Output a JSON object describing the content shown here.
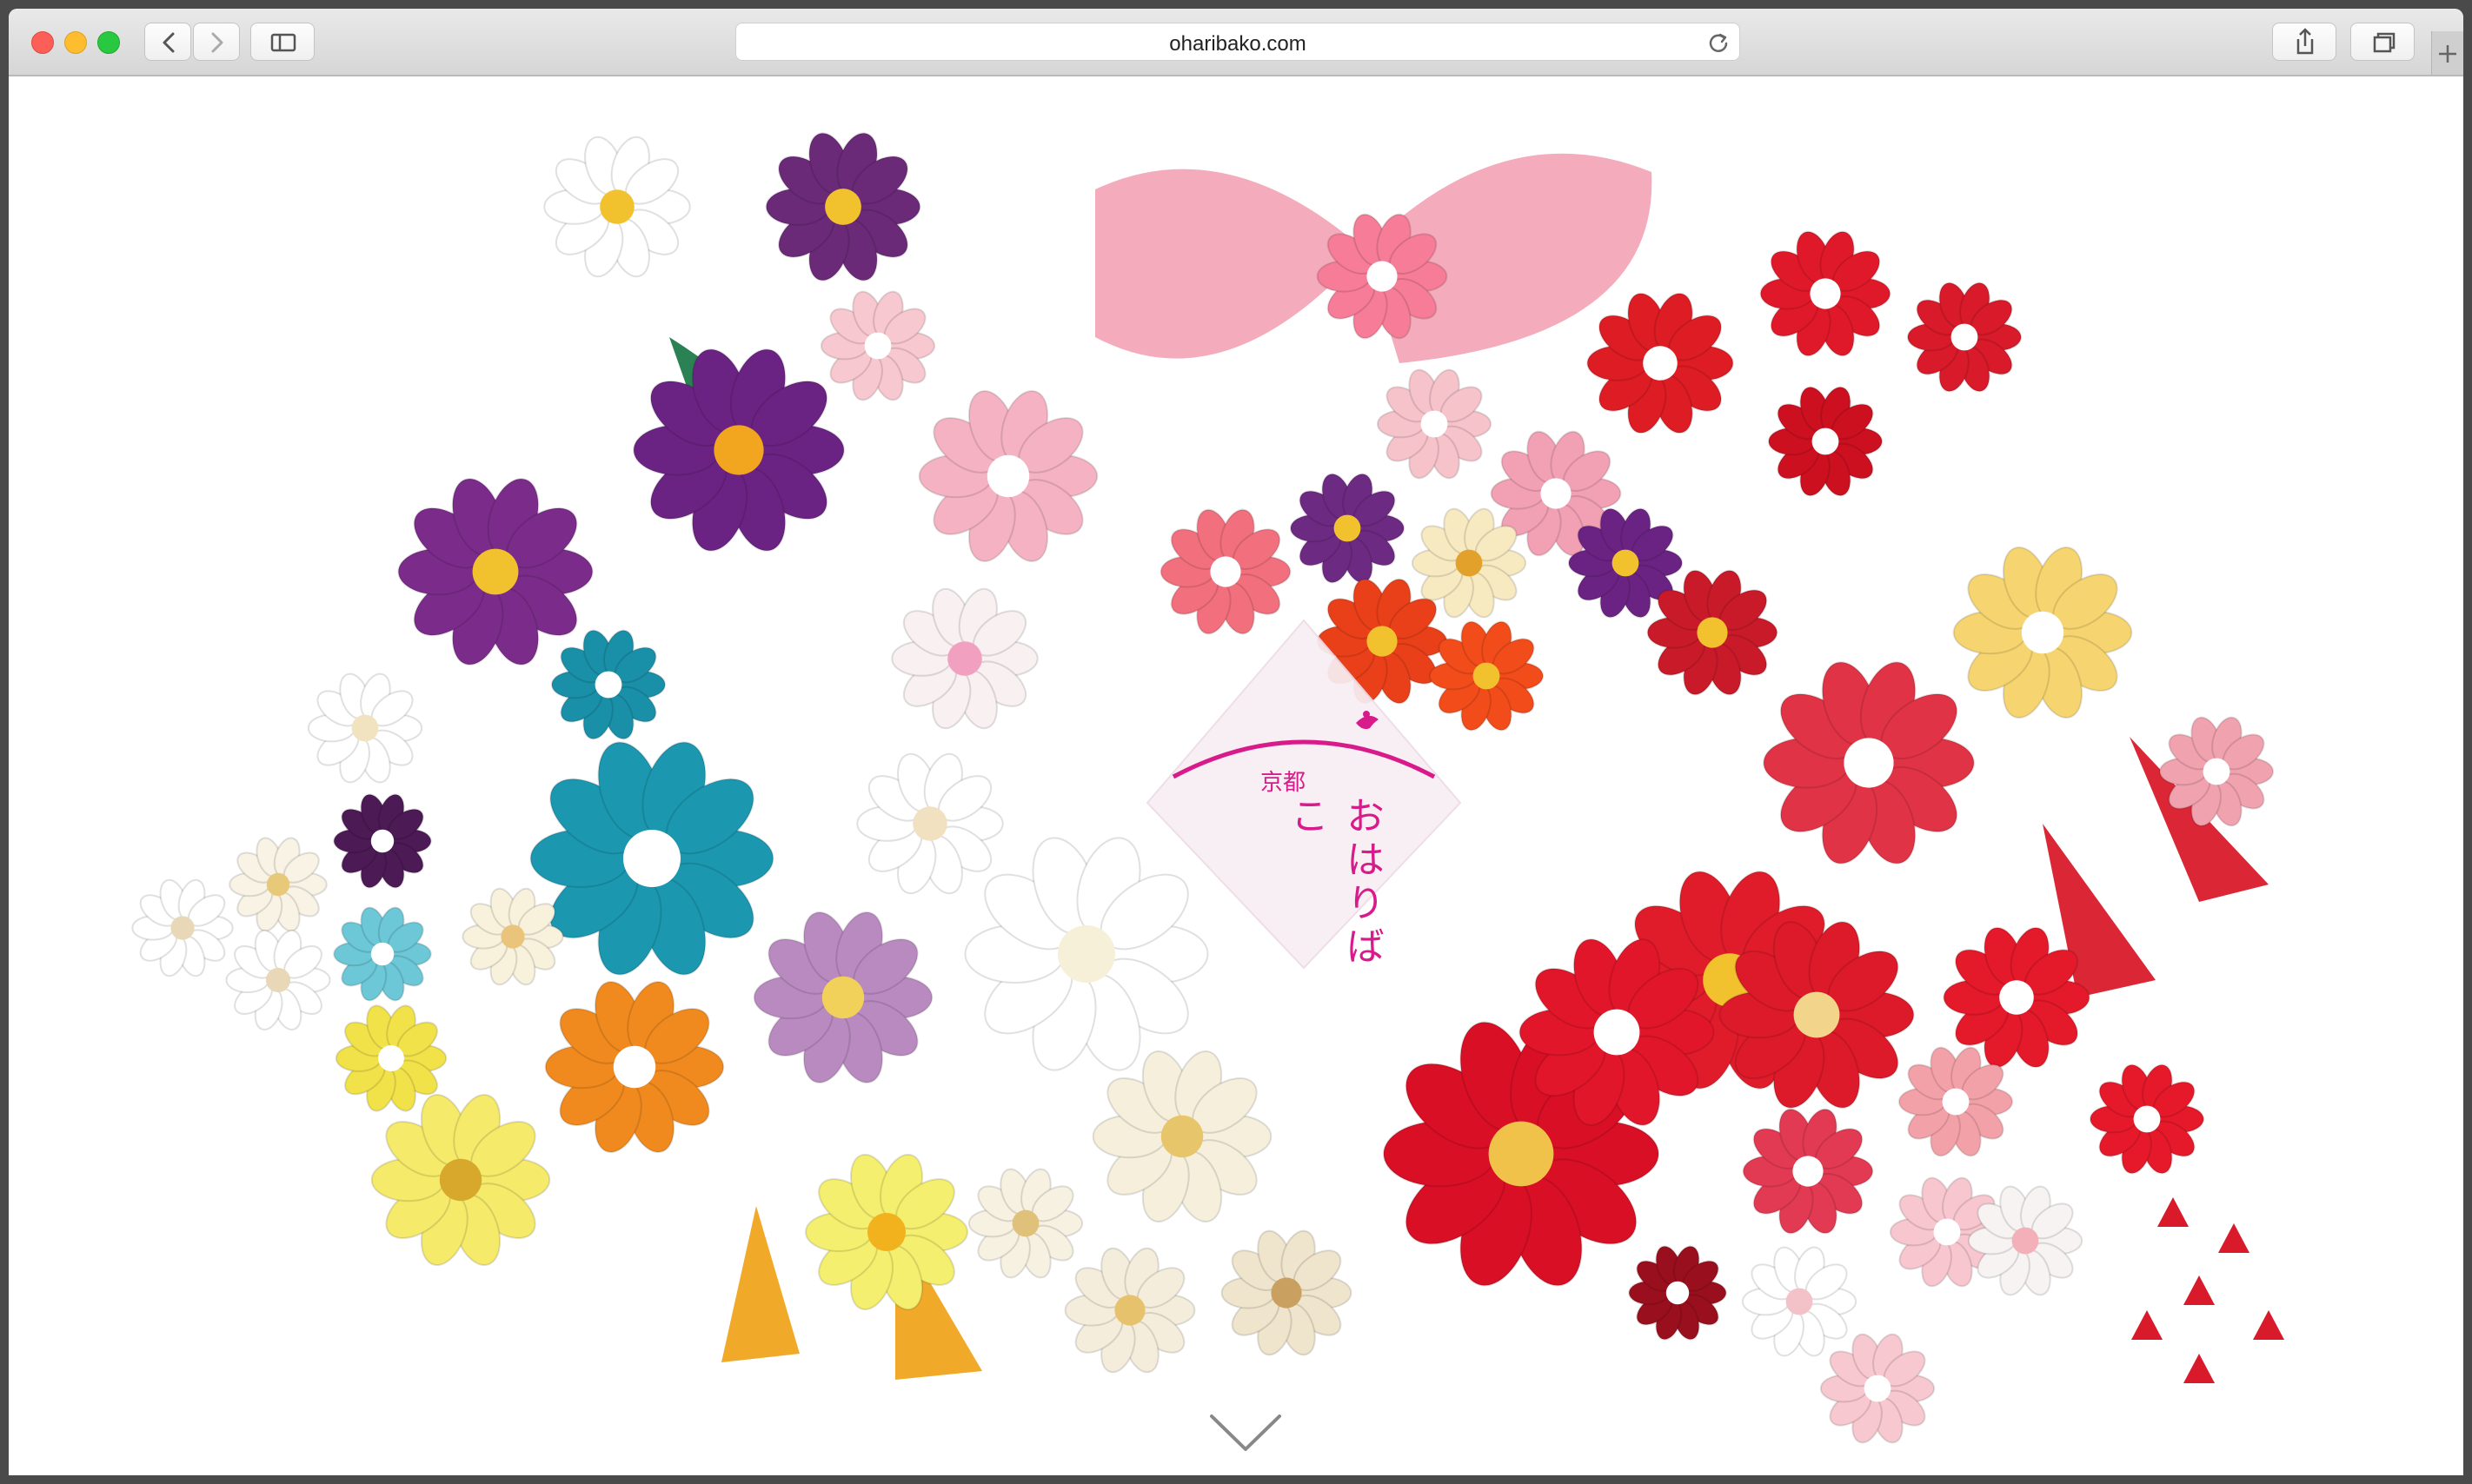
{
  "browser": {
    "url": "oharibako.com",
    "traffic_lights": {
      "close": "#fc5f57",
      "minimize": "#fdbd2e",
      "zoom": "#28c840"
    },
    "icons": {
      "back": "chevron-left-icon",
      "forward": "chevron-right-icon",
      "sidebar": "sidebar-icon",
      "reload": "reload-icon",
      "share": "share-icon",
      "tabs": "tabs-icon",
      "new_tab": "plus-icon"
    }
  },
  "hero": {
    "logo": {
      "city": "京都",
      "name": "おはりばこ",
      "accent_color": "#d81b8a"
    },
    "scroll_icon": "chevron-down-icon"
  }
}
